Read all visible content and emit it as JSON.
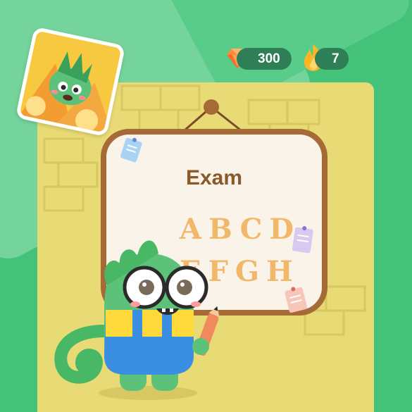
{
  "currency": {
    "gems": "300",
    "streak": "7"
  },
  "board": {
    "title": "Exam",
    "letters_row1": "ABCD",
    "letters_row2": "EFGH"
  },
  "icons": {
    "currency": "gem-icon",
    "streak": "flame-icon",
    "avatar": "dino-avatar"
  },
  "colors": {
    "background": "#45c27a",
    "panel": "#e8da74",
    "board_frame": "#a56a36",
    "accent_orange": "#f2b86a"
  }
}
